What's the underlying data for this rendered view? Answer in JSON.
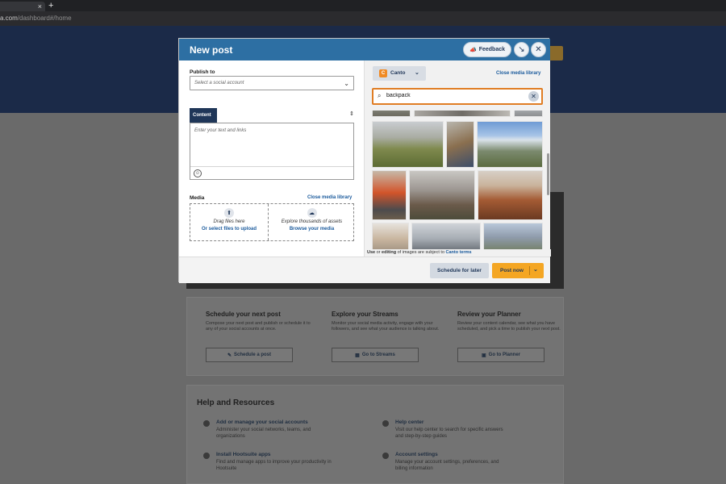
{
  "browser": {
    "tab_close": "×",
    "new_tab": "+",
    "url_prefix": "a.com",
    "url_path": "/dashboard#/home"
  },
  "dashboard": {
    "cta": [
      {
        "title": "Schedule your next post",
        "desc": "Compose your next post and publish or schedule it to any of your social accounts at once.",
        "button": "Schedule a post",
        "icon": "compose-icon"
      },
      {
        "title": "Explore your Streams",
        "desc": "Monitor your social media activity, engage with your followers, and see what your audience is talking about.",
        "button": "Go to Streams",
        "icon": "streams-icon"
      },
      {
        "title": "Review your Planner",
        "desc": "Review your content calendar, see what you have scheduled, and pick a time to publish your next post.",
        "button": "Go to Planner",
        "icon": "calendar-icon"
      }
    ],
    "help_heading": "Help and Resources",
    "help_items": [
      {
        "title": "Add or manage your social accounts",
        "desc": "Administer your social networks, teams, and organizations"
      },
      {
        "title": "Help center",
        "desc": "Visit our help center to search for specific answers and step-by-step guides"
      },
      {
        "title": "Install Hootsuite apps",
        "desc": "Find and manage apps to improve your productivity in Hootsuite"
      },
      {
        "title": "Account settings",
        "desc": "Manage your account settings, preferences, and billing information"
      }
    ]
  },
  "modal": {
    "title": "New post",
    "feedback_label": "Feedback",
    "minimize_glyph": "↘",
    "close_glyph": "✕",
    "publish_to_label": "Publish to",
    "account_placeholder": "Select a social account",
    "content_tab": "Content",
    "content_placeholder": "Enter your text and links",
    "media_label": "Media",
    "close_media_library": "Close media library",
    "drag_files": "Drag files here",
    "select_files": "Or select files to upload",
    "explore_assets": "Explore thousands of assets",
    "browse_media": "Browse your media",
    "schedule_later": "Schedule for later",
    "post_now": "Post now"
  },
  "media_library": {
    "source": "Canto",
    "close_label": "Close media library",
    "search_value": "backpack",
    "terms_use": "Use",
    "terms_or": " or ",
    "terms_editing": "editing",
    "terms_rest": " of images are subject to ",
    "terms_link": "Canto terms"
  },
  "colors": {
    "header_blue": "#2d6fa3",
    "navy": "#1f3658",
    "link_blue": "#1a5a9c",
    "accent_orange": "#f4a623",
    "search_border": "#e07d24"
  }
}
